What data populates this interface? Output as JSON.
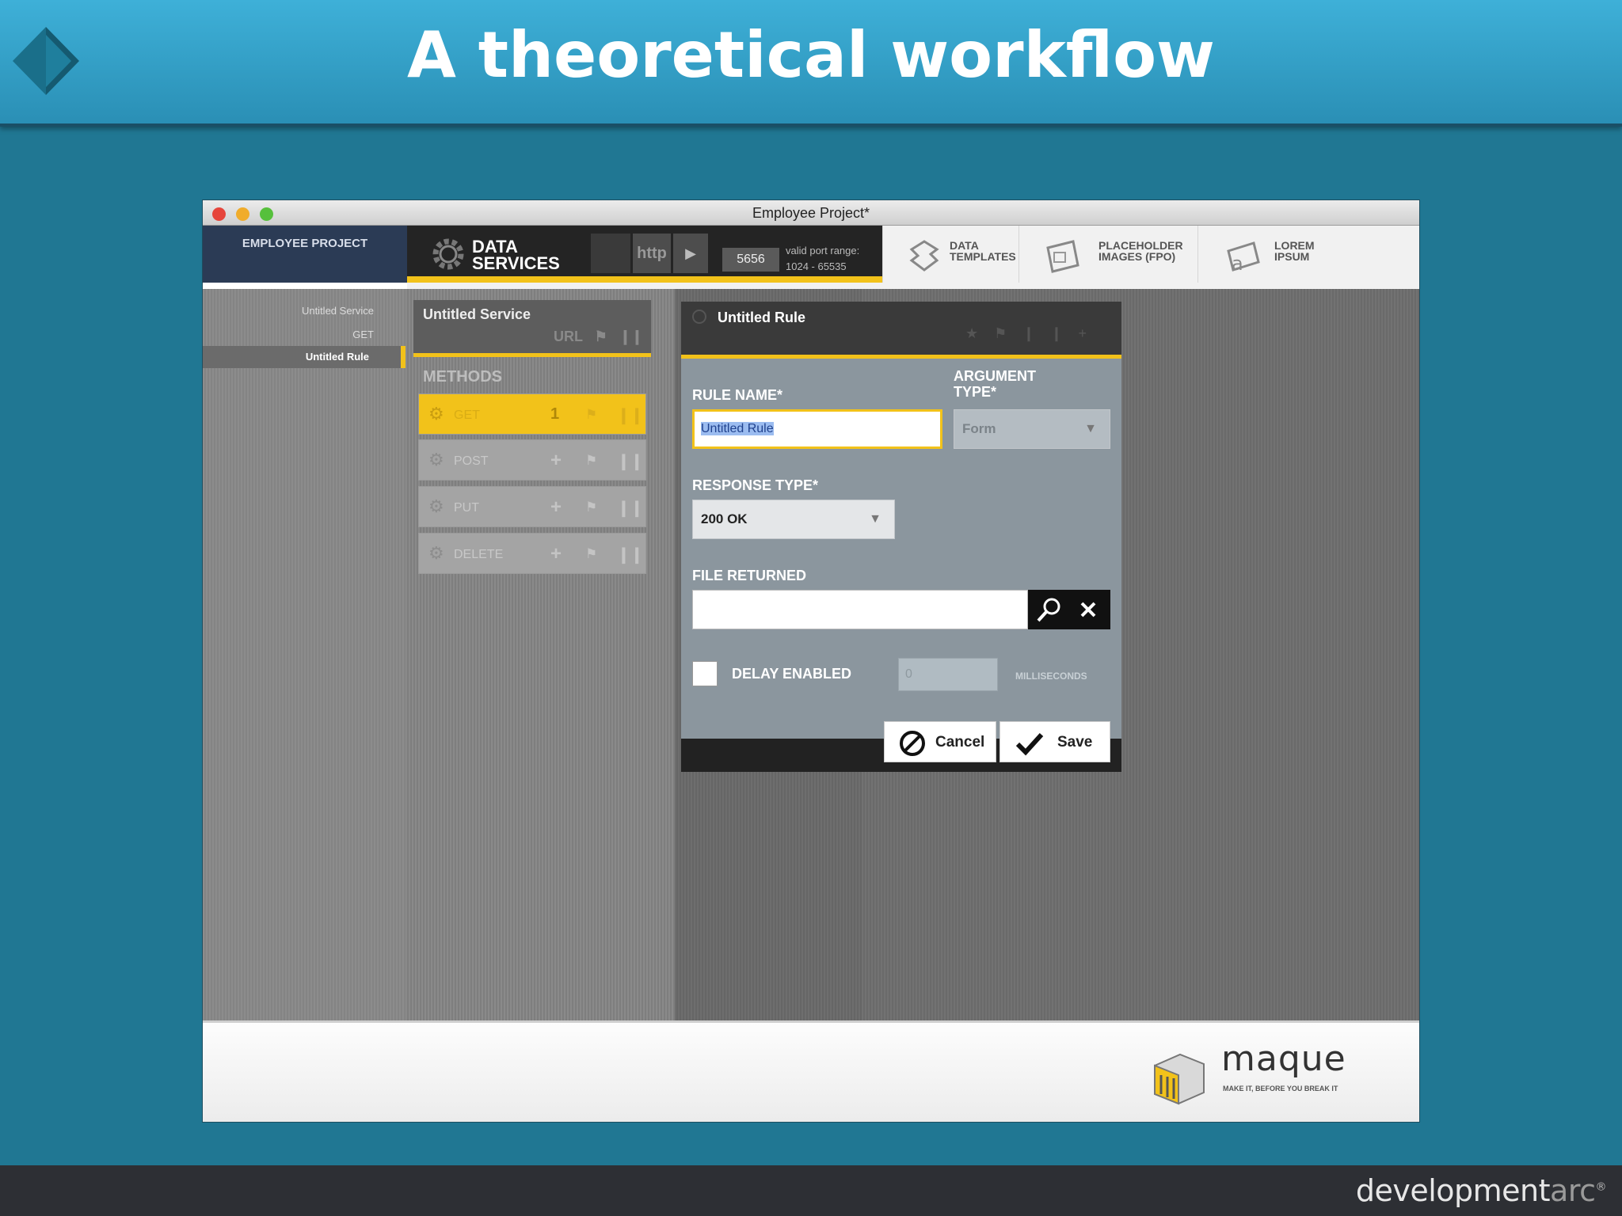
{
  "slide": {
    "title": "A theoretical workflow",
    "footer_brand_main": "development",
    "footer_brand_arc": "arc",
    "footer_brand_mark": "®"
  },
  "window": {
    "title": "Employee Project*"
  },
  "topnav": {
    "project_label": "EMPLOYEE PROJECT",
    "data_services_line1": "DATA",
    "data_services_line2": "SERVICES",
    "http_label": "http",
    "play_icon": "▶",
    "port_value": "5656",
    "port_range_line1": "valid port range:",
    "port_range_line2": "1024 - 65535",
    "tabs": [
      {
        "line1": "DATA",
        "line2": "TEMPLATES",
        "icon": "puzzle-icon"
      },
      {
        "line1": "PLACEHOLDER",
        "line2": "IMAGES (FPO)",
        "icon": "image-icon"
      },
      {
        "line1": "LOREM",
        "line2": "IPSUM",
        "icon": "text-icon"
      }
    ]
  },
  "sidebar": {
    "items": [
      "Untitled Service",
      "GET",
      "Untitled Rule"
    ]
  },
  "services": {
    "header_title": "Untitled Service",
    "header_sub": "URL",
    "methods_label": "METHODS",
    "methods": [
      {
        "name": "GET",
        "action": "1",
        "active": true
      },
      {
        "name": "POST",
        "action": "+",
        "active": false
      },
      {
        "name": "PUT",
        "action": "+",
        "active": false
      },
      {
        "name": "DELETE",
        "action": "+",
        "active": false
      }
    ]
  },
  "dialog": {
    "title": "Untitled Rule",
    "rule_name_label": "RULE NAME*",
    "rule_name_value": "Untitled Rule",
    "argument_type_label_1": "ARGUMENT",
    "argument_type_label_2": "TYPE*",
    "argument_type_value": "Form",
    "response_type_label": "RESPONSE TYPE*",
    "response_type_value": "200 OK",
    "file_returned_label": "FILE RETURNED",
    "file_returned_value": "",
    "delay_label": "DELAY ENABLED",
    "delay_value": "0",
    "milliseconds_label": "MILLISECONDS",
    "cancel_label": "Cancel",
    "save_label": "Save"
  },
  "brand": {
    "name": "maque",
    "tagline": "MAKE IT, BEFORE YOU BREAK IT"
  },
  "colors": {
    "slide_bg": "#207793",
    "header": "#3eb0d8",
    "accent_yellow": "#f2c21a",
    "dialog_bg": "#8b969e"
  }
}
